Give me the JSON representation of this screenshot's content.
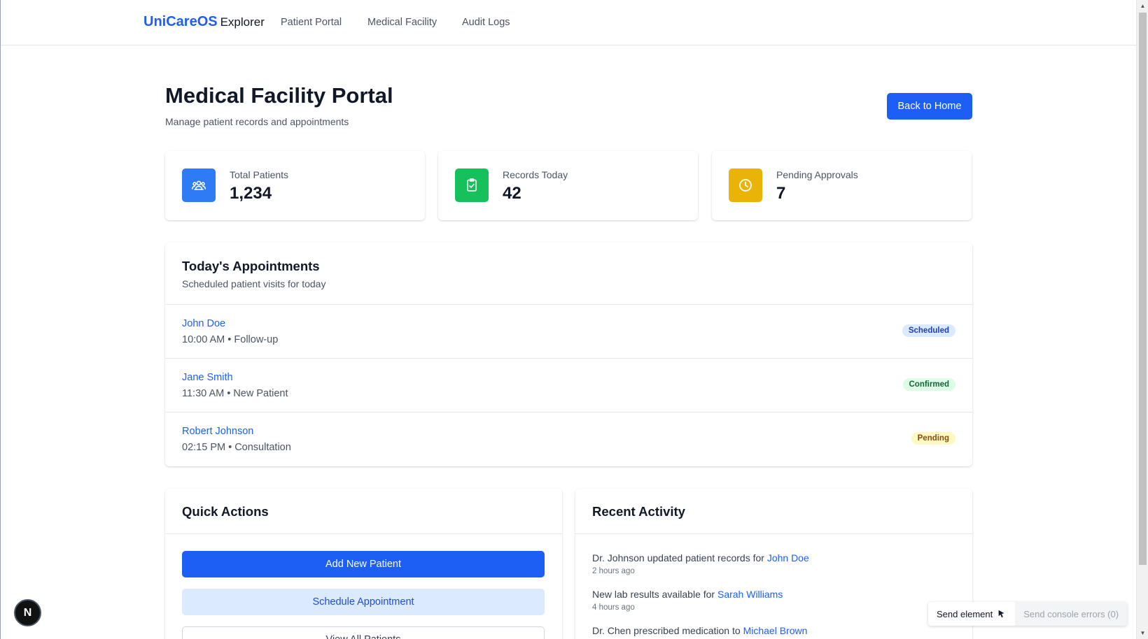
{
  "nav": {
    "brand": "UniCareOS",
    "brand_sub": "Explorer",
    "links": [
      "Patient Portal",
      "Medical Facility",
      "Audit Logs"
    ]
  },
  "header": {
    "title": "Medical Facility Portal",
    "subtitle": "Manage patient records and appointments",
    "back_button": "Back to Home"
  },
  "stats": [
    {
      "label": "Total Patients",
      "value": "1,234",
      "icon": "users-icon",
      "color": "#2f7af5"
    },
    {
      "label": "Records Today",
      "value": "42",
      "icon": "clipboard-check-icon",
      "color": "#16c15c"
    },
    {
      "label": "Pending Approvals",
      "value": "7",
      "icon": "clock-icon",
      "color": "#eab308"
    }
  ],
  "appointments": {
    "title": "Today's Appointments",
    "subtitle": "Scheduled patient visits for today",
    "items": [
      {
        "name": "John Doe",
        "meta": "10:00 AM • Follow-up",
        "status": "Scheduled"
      },
      {
        "name": "Jane Smith",
        "meta": "11:30 AM • New Patient",
        "status": "Confirmed"
      },
      {
        "name": "Robert Johnson",
        "meta": "02:15 PM • Consultation",
        "status": "Pending"
      }
    ]
  },
  "status_colors": {
    "Scheduled": {
      "bg": "#dbeafe",
      "fg": "#1e40af"
    },
    "Confirmed": {
      "bg": "#dcfce7",
      "fg": "#166534"
    },
    "Pending": {
      "bg": "#fef9c3",
      "fg": "#854d0e"
    }
  },
  "quick_actions": {
    "title": "Quick Actions",
    "buttons": [
      "Add New Patient",
      "Schedule Appointment",
      "View All Patients"
    ]
  },
  "recent_activity": {
    "title": "Recent Activity",
    "items": [
      {
        "text": "Dr. Johnson updated patient records for ",
        "link": "John Doe",
        "time": "2 hours ago"
      },
      {
        "text": "New lab results available for ",
        "link": "Sarah Williams",
        "time": "4 hours ago"
      },
      {
        "text": "Dr. Chen prescribed medication to ",
        "link": "Michael Brown",
        "time": ""
      }
    ]
  },
  "devtools": {
    "badge": "N",
    "send_element": "Send element",
    "send_errors": "Send console errors (0)"
  }
}
